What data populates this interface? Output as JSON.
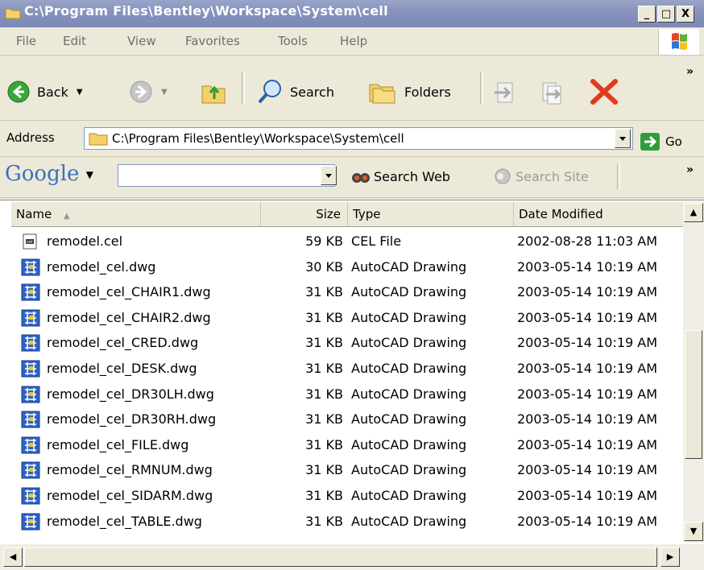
{
  "window": {
    "title": "C:\\Program Files\\Bentley\\Workspace\\System\\cell"
  },
  "title_buttons": {
    "minimize": "_",
    "maximize": "□",
    "close": "X"
  },
  "menu": [
    "File",
    "Edit",
    "View",
    "Favorites",
    "Tools",
    "Help"
  ],
  "toolbar": {
    "back": "Back",
    "search": "Search",
    "folders": "Folders"
  },
  "address": {
    "label": "Address",
    "value": "C:\\Program Files\\Bentley\\Workspace\\System\\cell",
    "go": "Go"
  },
  "google": {
    "logo": "Google",
    "search_web": "Search Web",
    "search_site": "Search Site",
    "query": ""
  },
  "columns": [
    "Name",
    "Size",
    "Type",
    "Date Modified"
  ],
  "files": [
    {
      "name": "remodel.cel",
      "size": "59 KB",
      "type": "CEL File",
      "modified": "2002-08-28 11:03 AM",
      "icon": "cel-file-icon"
    },
    {
      "name": "remodel_cel.dwg",
      "size": "30 KB",
      "type": "AutoCAD Drawing",
      "modified": "2003-05-14 10:19 AM",
      "icon": "dwg-file-icon"
    },
    {
      "name": "remodel_cel_CHAIR1.dwg",
      "size": "31 KB",
      "type": "AutoCAD Drawing",
      "modified": "2003-05-14 10:19 AM",
      "icon": "dwg-file-icon"
    },
    {
      "name": "remodel_cel_CHAIR2.dwg",
      "size": "31 KB",
      "type": "AutoCAD Drawing",
      "modified": "2003-05-14 10:19 AM",
      "icon": "dwg-file-icon"
    },
    {
      "name": "remodel_cel_CRED.dwg",
      "size": "31 KB",
      "type": "AutoCAD Drawing",
      "modified": "2003-05-14 10:19 AM",
      "icon": "dwg-file-icon"
    },
    {
      "name": "remodel_cel_DESK.dwg",
      "size": "31 KB",
      "type": "AutoCAD Drawing",
      "modified": "2003-05-14 10:19 AM",
      "icon": "dwg-file-icon"
    },
    {
      "name": "remodel_cel_DR30LH.dwg",
      "size": "31 KB",
      "type": "AutoCAD Drawing",
      "modified": "2003-05-14 10:19 AM",
      "icon": "dwg-file-icon"
    },
    {
      "name": "remodel_cel_DR30RH.dwg",
      "size": "31 KB",
      "type": "AutoCAD Drawing",
      "modified": "2003-05-14 10:19 AM",
      "icon": "dwg-file-icon"
    },
    {
      "name": "remodel_cel_FILE.dwg",
      "size": "31 KB",
      "type": "AutoCAD Drawing",
      "modified": "2003-05-14 10:19 AM",
      "icon": "dwg-file-icon"
    },
    {
      "name": "remodel_cel_RMNUM.dwg",
      "size": "31 KB",
      "type": "AutoCAD Drawing",
      "modified": "2003-05-14 10:19 AM",
      "icon": "dwg-file-icon"
    },
    {
      "name": "remodel_cel_SIDARM.dwg",
      "size": "31 KB",
      "type": "AutoCAD Drawing",
      "modified": "2003-05-14 10:19 AM",
      "icon": "dwg-file-icon"
    },
    {
      "name": "remodel_cel_TABLE.dwg",
      "size": "31 KB",
      "type": "AutoCAD Drawing",
      "modified": "2003-05-14 10:19 AM",
      "icon": "dwg-file-icon"
    }
  ],
  "colors": {
    "titlebar": "#8792bd",
    "chrome": "#ECE9D8",
    "go_green": "#2e9e3a",
    "delete_red": "#e03a1e"
  }
}
